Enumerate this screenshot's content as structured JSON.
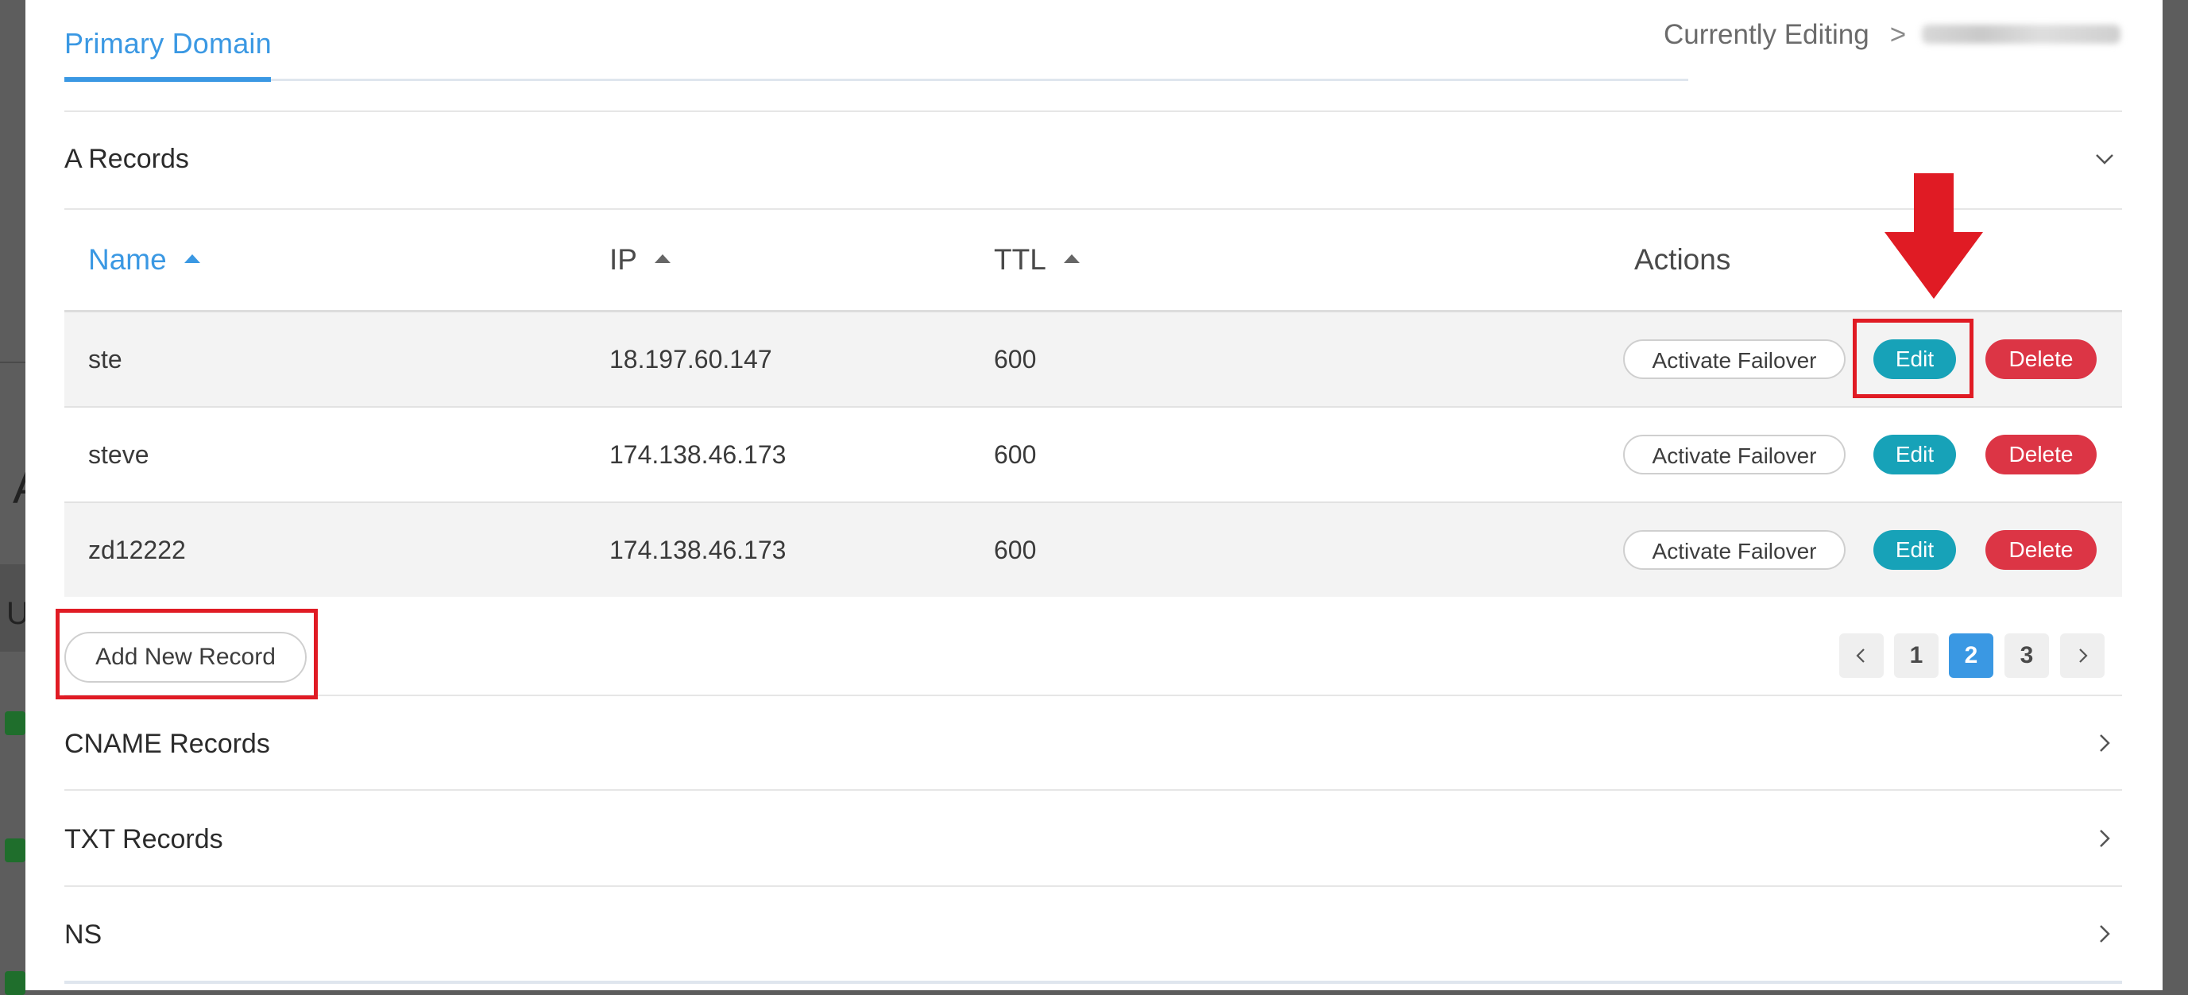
{
  "header": {
    "tab_label": "Primary Domain",
    "editing_label": "Currently Editing",
    "separator": ">"
  },
  "a_records": {
    "title": "A Records",
    "columns": {
      "name": "Name",
      "ip": "IP",
      "ttl": "TTL",
      "actions": "Actions"
    },
    "rows": [
      {
        "name": "ste",
        "ip": "18.197.60.147",
        "ttl": "600"
      },
      {
        "name": "steve",
        "ip": "174.138.46.173",
        "ttl": "600"
      },
      {
        "name": "zd12222",
        "ip": "174.138.46.173",
        "ttl": "600"
      }
    ],
    "actions": {
      "failover": "Activate Failover",
      "edit": "Edit",
      "delete": "Delete"
    },
    "add_label": "Add New Record",
    "pagination": {
      "pages": [
        "1",
        "2",
        "3"
      ],
      "current": "2"
    }
  },
  "sections": [
    {
      "title": "CNAME Records"
    },
    {
      "title": "TXT Records"
    },
    {
      "title": "NS"
    }
  ],
  "icons": {
    "collapse": "chevron-down-icon",
    "expand": "chevron-right-icon",
    "prev": "chevron-left-icon",
    "next": "chevron-right-icon",
    "sort": "sort-asc-icon",
    "annotation": "red-down-arrow-icon"
  },
  "colors": {
    "accent": "#3a98e3",
    "edit": "#17a2b8",
    "delete": "#dc3545",
    "annotation": "#e01b24"
  }
}
